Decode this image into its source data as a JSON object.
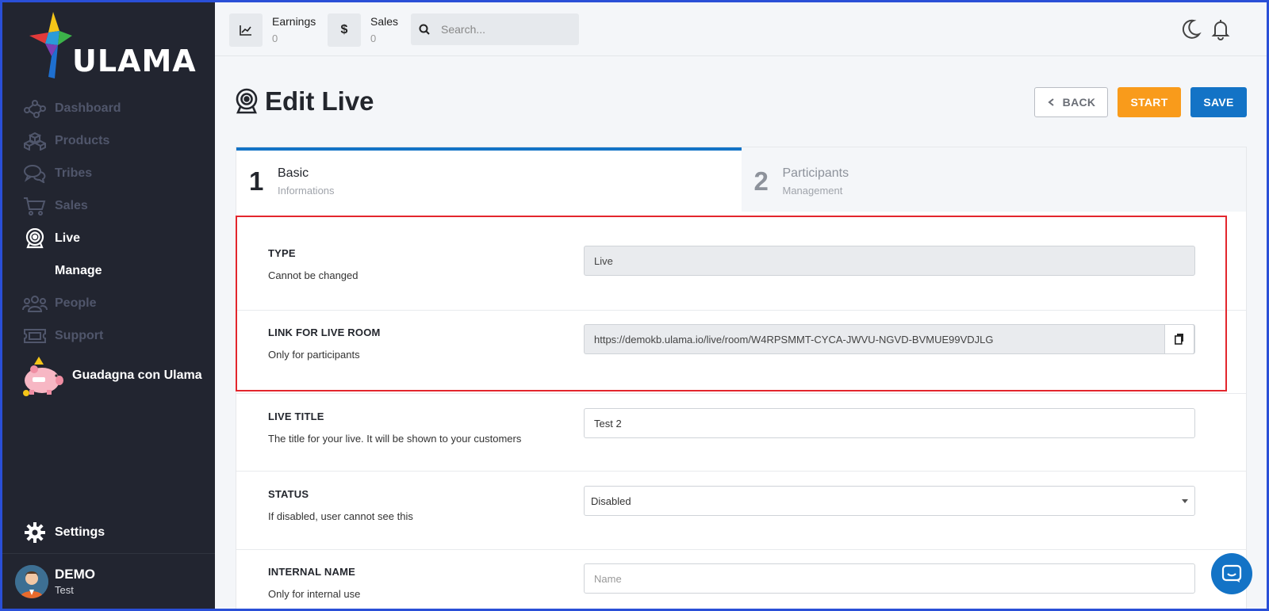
{
  "brand": {
    "logo_text": "ULAMA"
  },
  "sidebar": {
    "items": [
      {
        "label": "Dashboard",
        "icon": "share-nodes-icon"
      },
      {
        "label": "Products",
        "icon": "cubes-icon"
      },
      {
        "label": "Tribes",
        "icon": "comments-icon"
      },
      {
        "label": "Sales",
        "icon": "cart-icon"
      },
      {
        "label": "Live",
        "icon": "webcam-icon"
      },
      {
        "label": "People",
        "icon": "users-icon"
      },
      {
        "label": "Support",
        "icon": "ticket-icon"
      }
    ],
    "sub_item": "Manage",
    "promo": "Guadagna con Ulama",
    "settings": "Settings",
    "user": {
      "name": "DEMO",
      "role": "Test"
    }
  },
  "topbar": {
    "earnings_label": "Earnings",
    "earnings_value": "0",
    "sales_label": "Sales",
    "sales_value": "0",
    "sales_symbol": "$",
    "search_placeholder": "Search..."
  },
  "page": {
    "title": "Edit Live",
    "back_label": "BACK",
    "start_label": "START",
    "save_label": "SAVE"
  },
  "steps": [
    {
      "num": "1",
      "title": "Basic",
      "subtitle": "Informations"
    },
    {
      "num": "2",
      "title": "Participants",
      "subtitle": "Management"
    }
  ],
  "form": {
    "type": {
      "label": "TYPE",
      "hint": "Cannot be changed",
      "value": "Live"
    },
    "link": {
      "label": "LINK FOR LIVE ROOM",
      "hint": "Only for participants",
      "value": "https://demokb.ulama.io/live/room/W4RPSMMT-CYCA-JWVU-NGVD-BVMUE99VDJLG"
    },
    "title": {
      "label": "LIVE TITLE",
      "hint": "The title for your live. It will be shown to your customers",
      "value": "Test 2"
    },
    "status": {
      "label": "STATUS",
      "hint": "If disabled, user cannot see this",
      "value": "Disabled"
    },
    "internal_name": {
      "label": "INTERNAL NAME",
      "hint": "Only for internal use",
      "placeholder": "Name"
    }
  },
  "colors": {
    "sidebar_bg": "#222530",
    "primary": "#1373c6",
    "start": "#f99b1b",
    "highlight": "#e3262d"
  }
}
